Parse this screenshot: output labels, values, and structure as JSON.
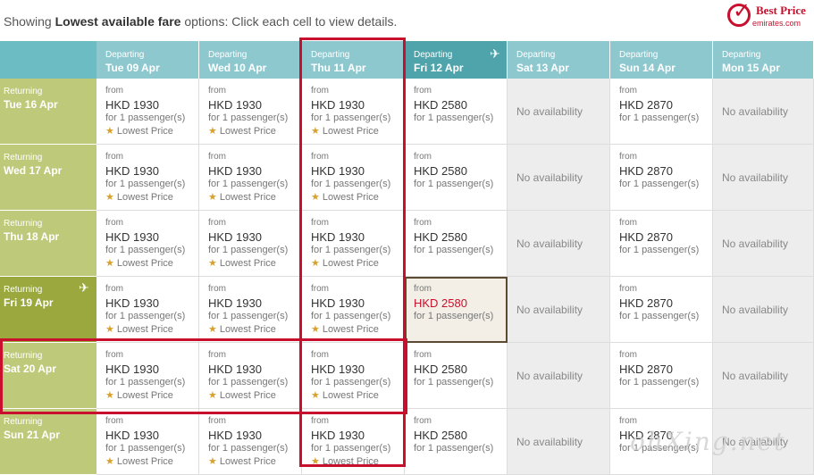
{
  "intro": {
    "pre": "Showing ",
    "bold": "Lowest available fare",
    "post": " options: Click each cell to view details."
  },
  "logo": {
    "line1": "Best Price",
    "line2": "emirates.com"
  },
  "departing": [
    {
      "label": "Departing",
      "date": "Tue 09 Apr"
    },
    {
      "label": "Departing",
      "date": "Wed 10 Apr"
    },
    {
      "label": "Departing",
      "date": "Thu 11 Apr"
    },
    {
      "label": "Departing",
      "date": "Fri 12 Apr"
    },
    {
      "label": "Departing",
      "date": "Sat 13 Apr"
    },
    {
      "label": "Departing",
      "date": "Sun 14 Apr"
    },
    {
      "label": "Departing",
      "date": "Mon 15 Apr"
    }
  ],
  "returning": [
    {
      "label": "Returning",
      "date": "Tue 16 Apr"
    },
    {
      "label": "Returning",
      "date": "Wed 17 Apr"
    },
    {
      "label": "Returning",
      "date": "Thu 18 Apr"
    },
    {
      "label": "Returning",
      "date": "Fri 19 Apr"
    },
    {
      "label": "Returning",
      "date": "Sat 20 Apr"
    },
    {
      "label": "Returning",
      "date": "Sun 21 Apr"
    }
  ],
  "fare": {
    "from": "from",
    "pax": "for 1 passenger(s)",
    "lowest": "Lowest Price",
    "na": "No availability",
    "p1930": "HKD 1930",
    "p2580": "HKD 2580",
    "p2870": "HKD 2870"
  },
  "selected": {
    "departing_index": 3,
    "returning_index": 3
  },
  "colors": {
    "header": "#8ec8cf",
    "header_selected": "#4fa4ab",
    "returning": "#bfc97a",
    "returning_selected": "#9aa83e",
    "highlight_red": "#c8102e"
  },
  "watermark": "ohXing.net"
}
